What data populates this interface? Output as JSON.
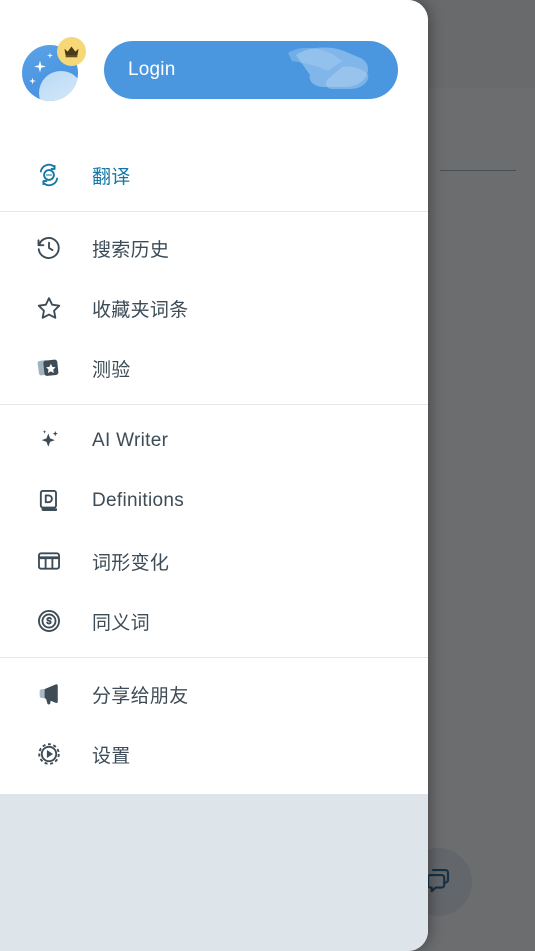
{
  "drawer": {
    "header": {
      "avatar_name": "profile-avatar",
      "badge_name": "premium-crown-badge",
      "login_label": "Login",
      "button_color": "#4a97e0",
      "badge_color": "#f7d878"
    },
    "groups": [
      {
        "items": [
          {
            "id": "translate",
            "label": "翻译",
            "icon": "translate-icon",
            "active": true
          }
        ]
      },
      {
        "items": [
          {
            "id": "search-history",
            "label": "搜索历史",
            "icon": "history-clock-icon",
            "active": false
          },
          {
            "id": "favorites",
            "label": "收藏夹词条",
            "icon": "star-icon",
            "active": false
          },
          {
            "id": "quiz",
            "label": "测验",
            "icon": "quiz-cards-icon",
            "active": false
          }
        ]
      },
      {
        "items": [
          {
            "id": "ai-writer",
            "label": "AI Writer",
            "icon": "sparkle-icon",
            "active": false
          },
          {
            "id": "definitions",
            "label": "Definitions",
            "icon": "dictionary-book-icon",
            "active": false
          },
          {
            "id": "inflections",
            "label": "词形变化",
            "icon": "table-grid-icon",
            "active": false
          },
          {
            "id": "synonyms",
            "label": "同义词",
            "icon": "synonym-s-circle-icon",
            "active": false
          }
        ]
      },
      {
        "items": [
          {
            "id": "share",
            "label": "分享给朋友",
            "icon": "megaphone-icon",
            "active": false
          },
          {
            "id": "settings",
            "label": "设置",
            "icon": "gear-icon",
            "active": false
          }
        ]
      }
    ],
    "footer_color": "#dde4ea",
    "active_color": "#1577a8",
    "text_color": "#3d4c56"
  },
  "background": {
    "fab_icon": "chat-bubbles-icon",
    "scrim_color": "#626365"
  }
}
